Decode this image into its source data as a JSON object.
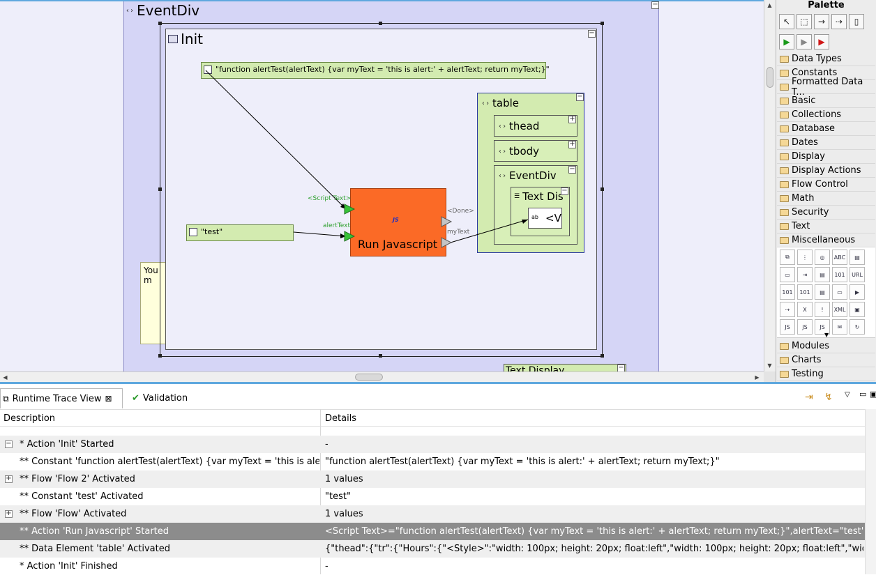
{
  "canvas": {
    "outer": {
      "title": "EventDiv"
    },
    "init": {
      "title": "Init"
    },
    "script_constant": {
      "text": "\"function alertTest(alertText) {var myText = 'this is alert:' + alertText; return myText;}\""
    },
    "test_constant": {
      "text": "\"test\""
    },
    "run_js": {
      "label": "Run Javascript",
      "js_badge": "JS",
      "port_script": "<Script Text>",
      "port_alert": "alertText",
      "port_done": "<Done>",
      "port_mytext": "myText"
    },
    "table": {
      "title": "table",
      "thead": "thead",
      "tbody": "tbody",
      "eventdiv": "EventDiv",
      "textdisplay": "Text Dis",
      "value": "<V"
    },
    "note": {
      "text": "You m"
    },
    "bottom_textdisplay": {
      "title": "Text Display"
    },
    "toggle_expand": "+",
    "toggle_collapse": "−"
  },
  "palette": {
    "title": "Palette",
    "groups": [
      "Data Types",
      "Constants",
      "Formatted Data T...",
      "Basic",
      "Collections",
      "Database",
      "Dates",
      "Display",
      "Display Actions",
      "Flow Control",
      "Math",
      "Security",
      "Text",
      "Miscellaneous"
    ],
    "groups_after": [
      "Modules",
      "Charts",
      "Testing"
    ],
    "misc_icons": [
      "copy",
      "tree",
      "globe",
      "mime",
      "export",
      "flow",
      "ins",
      "doc",
      "csv",
      "url",
      "csvx",
      "csvr",
      "docx",
      "shape",
      "run",
      "arrow",
      "excel",
      "warn",
      "xml",
      "box",
      "js1",
      "js2",
      "js3",
      "mail",
      "cycle"
    ],
    "misc_labels": [
      "⧉",
      "⋮",
      "◎",
      "ABC",
      "▤",
      "▭",
      "⇥",
      "▤",
      "101",
      "URL",
      "101",
      "101",
      "▤",
      "▭",
      "▶",
      "⇢",
      "X",
      "!",
      "XML",
      "▣",
      "JS",
      "JS",
      "JS",
      "✉",
      "↻"
    ]
  },
  "bottom": {
    "tabs": [
      {
        "label": "Runtime Trace View",
        "close": "⊠"
      },
      {
        "label": "Validation"
      }
    ],
    "columns": {
      "description": "Description",
      "details": "Details"
    },
    "rows": [
      {
        "expander": "−",
        "description": "* Action 'Init' Started",
        "details": "-",
        "style": "alt"
      },
      {
        "expander": "",
        "description": "** Constant 'function alertTest(alertText) {var myText = 'this is aler",
        "details": "\"function alertTest(alertText) {var myText = 'this is alert:' + alertText; return myText;}\"",
        "style": ""
      },
      {
        "expander": "+",
        "description": "** Flow 'Flow 2' Activated",
        "details": "1 values",
        "style": "alt"
      },
      {
        "expander": "",
        "description": "** Constant 'test' Activated",
        "details": "\"test\"",
        "style": ""
      },
      {
        "expander": "+",
        "description": "** Flow 'Flow' Activated",
        "details": "1 values",
        "style": "alt"
      },
      {
        "expander": "",
        "description": "** Action 'Run Javascript' Started",
        "details": "<Script Text>=\"function alertTest(alertText) {var myText = 'this is alert:' + alertText; return myText;}\",alertText=\"test\"",
        "style": "sel"
      },
      {
        "expander": "",
        "description": "** Data Element 'table' Activated",
        "details": "{\"thead\":{\"tr\":{\"Hours\":{\"<Style>\":\"width: 100px; height: 20px; float:left\",\"width: 100px; height: 20px; float:left\",\"width:",
        "style": "alt"
      },
      {
        "expander": "",
        "description": "* Action 'Init' Finished",
        "details": "-",
        "style": ""
      }
    ]
  },
  "colors": {
    "accent": "#5fa8de",
    "run_js": "#fb6a26",
    "constant": "#d3ebb0",
    "selected_row": "#8c8c8c"
  }
}
